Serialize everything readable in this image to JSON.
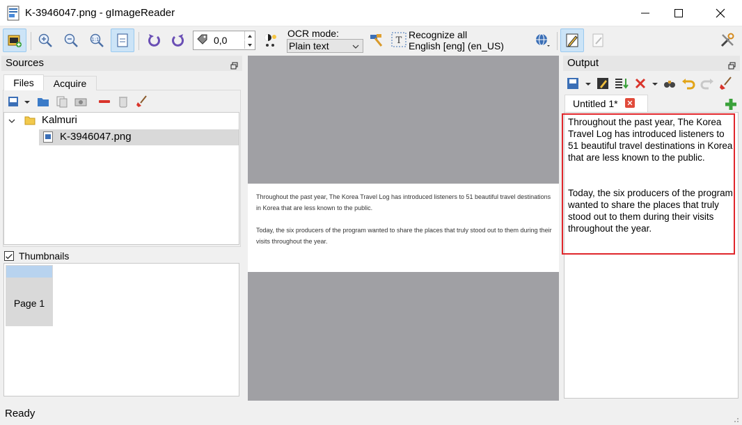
{
  "window": {
    "title": "K-3946047.png - gImageReader",
    "minimize_icon": "minimize-icon",
    "maximize_icon": "maximize-icon",
    "close_icon": "close-icon"
  },
  "toolbar": {
    "rotation_value": "0,0",
    "ocr_mode_label": "OCR mode:",
    "ocr_mode_value": "Plain text",
    "recognize_label": "Recognize all",
    "language_label": "English [eng] (en_US)"
  },
  "sources": {
    "title": "Sources",
    "tabs": [
      {
        "label": "Files",
        "active": true
      },
      {
        "label": "Acquire",
        "active": false
      }
    ],
    "tree": {
      "folder": "Kalmuri",
      "file": "K-3946047.png"
    },
    "thumbnails_label": "Thumbnails",
    "thumbnails_checked": true,
    "thumbnail_page": "Page 1"
  },
  "document": {
    "paragraphs": [
      "Throughout the past year, The Korea Travel Log has introduced listeners to 51 beautiful travel destinations in Korea that are less known to the public.",
      "Today, the six producers of the program wanted to share the places that truly stood out to them during their visits throughout the year."
    ]
  },
  "output": {
    "title": "Output",
    "tab_label": "Untitled 1*",
    "text_paragraphs": [
      "Throughout the past year, The Korea Travel Log has introduced listeners to 51 beautiful travel destinations in Korea that are less known to the public.",
      "Today, the six producers of the program wanted to share the places that truly stood out to them during their visits throughout the year."
    ]
  },
  "status": {
    "text": "Ready"
  },
  "colors": {
    "highlight_border": "#e0262b",
    "active_button_bg": "#cce4f7",
    "viewer_bg": "#a0a0a4"
  }
}
